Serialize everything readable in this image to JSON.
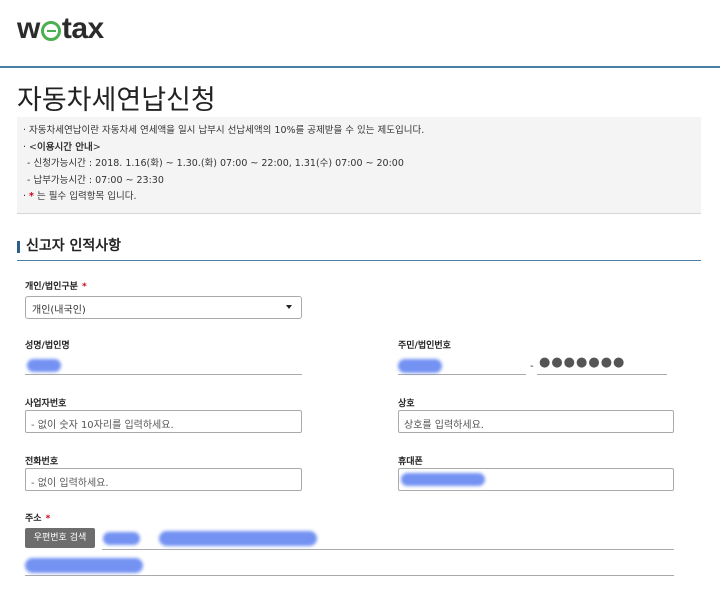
{
  "brand": {
    "logo_text_pre": "w",
    "logo_text_post": "tax"
  },
  "page": {
    "title": "자동차세연납신청"
  },
  "notice": {
    "line1": "· 자동차세연납이란 자동차세 연세액을 일시 납부시 선납세액의 10%를 공제받을 수 있는 제도입니다.",
    "line2_prefix": "· <",
    "line2_bold": "이용시간 안내",
    "line2_suffix": ">",
    "line3": "- 신청가능시간 : 2018. 1.16(화) ~ 1.30.(화) 07:00 ~ 22:00, 1.31(수) 07:00 ~ 20:00",
    "line4": "- 납부가능시간 : 07:00 ~ 23:30",
    "line5_prefix": "· ",
    "line5_star": "*",
    "line5_suffix": " 는 필수 입력항목 입니다."
  },
  "section": {
    "title": "신고자 인적사항"
  },
  "form": {
    "required_mark": "*",
    "type": {
      "label": "개인/법인구분",
      "value": "개인(내국인)"
    },
    "name": {
      "label": "성명/법인명"
    },
    "id_number": {
      "label": "주민/법인번호",
      "separator": "-",
      "masked_back": "●●●●●●●"
    },
    "business_number": {
      "label": "사업자번호",
      "placeholder": "- 없이 숫자 10자리를 입력하세요."
    },
    "trade_name": {
      "label": "상호",
      "placeholder": "상호를 입력하세요."
    },
    "phone": {
      "label": "전화번호",
      "placeholder": "- 없이 입력하세요."
    },
    "mobile": {
      "label": "휴대폰"
    },
    "address": {
      "label": "주소",
      "zip_button": "우편번호 검색"
    }
  },
  "colors": {
    "accent_line": "#4a7fa5",
    "required": "#d0021b",
    "logo_green": "#4caf50",
    "button_gray": "#6d6d6d"
  }
}
